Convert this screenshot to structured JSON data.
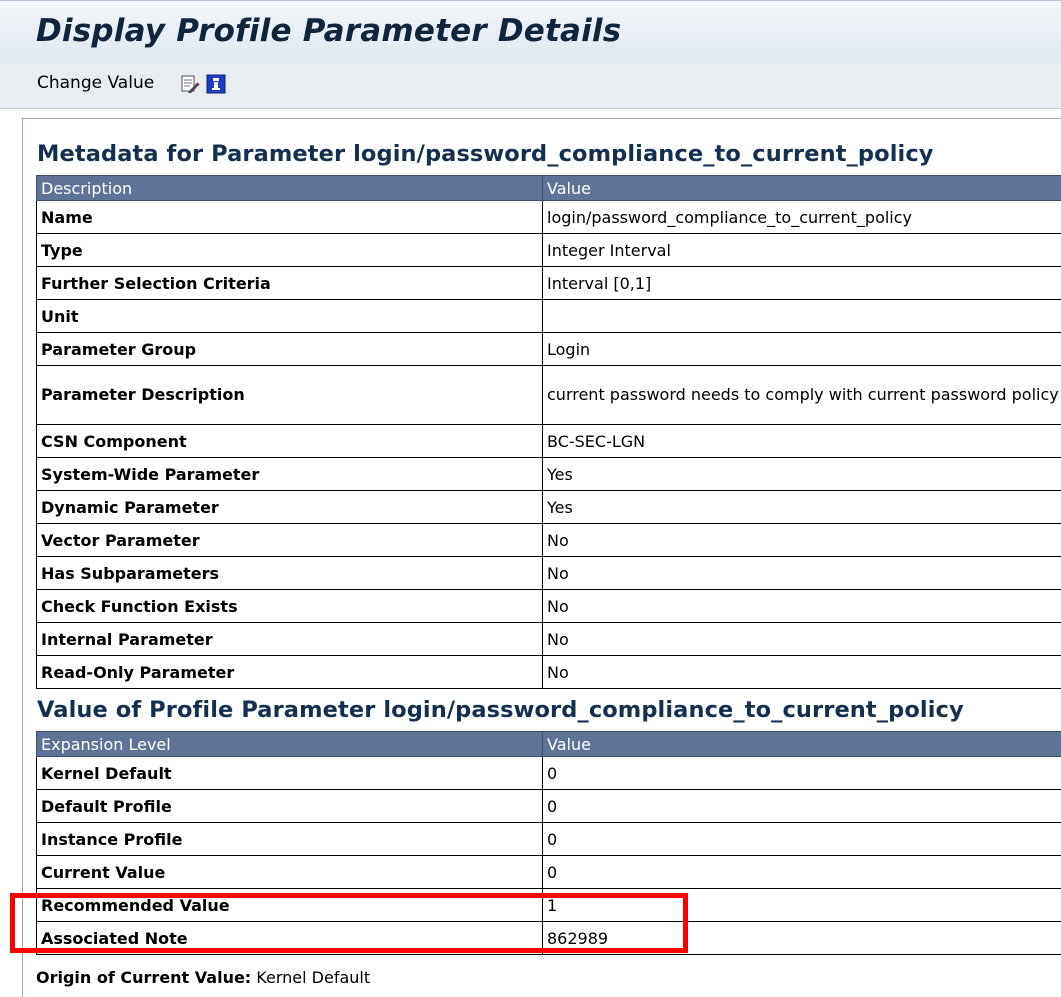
{
  "header": {
    "title": "Display Profile Parameter Details"
  },
  "toolbar": {
    "change_value_label": "Change Value",
    "icons": [
      "edit-icon",
      "info-icon"
    ]
  },
  "metadata_section": {
    "title": "Metadata for Parameter login/password_compliance_to_current_policy",
    "columns": [
      "Description",
      "Value"
    ],
    "rows": [
      {
        "key": "Name",
        "value": "login/password_compliance_to_current_policy"
      },
      {
        "key": "Type",
        "value": "Integer Interval"
      },
      {
        "key": "Further Selection Criteria",
        "value": "Interval [0,1]"
      },
      {
        "key": "Unit",
        "value": ""
      },
      {
        "key": "Parameter Group",
        "value": "Login"
      },
      {
        "key": "Parameter Description",
        "value": "current password needs to comply with current password policy"
      },
      {
        "key": "CSN Component",
        "value": "BC-SEC-LGN"
      },
      {
        "key": "System-Wide Parameter",
        "value": "Yes"
      },
      {
        "key": "Dynamic Parameter",
        "value": "Yes"
      },
      {
        "key": "Vector Parameter",
        "value": "No"
      },
      {
        "key": "Has Subparameters",
        "value": "No"
      },
      {
        "key": "Check Function Exists",
        "value": "No"
      },
      {
        "key": "Internal Parameter",
        "value": "No"
      },
      {
        "key": "Read-Only Parameter",
        "value": "No"
      }
    ]
  },
  "value_section": {
    "title": "Value of Profile Parameter login/password_compliance_to_current_policy",
    "columns": [
      "Expansion Level",
      "Value"
    ],
    "rows": [
      {
        "key": "Kernel Default",
        "value": "0"
      },
      {
        "key": "Default Profile",
        "value": "0"
      },
      {
        "key": "Instance Profile",
        "value": "0"
      },
      {
        "key": "Current Value",
        "value": "0"
      },
      {
        "key": "Recommended Value",
        "value": "1"
      },
      {
        "key": "Associated Note",
        "value": "862989"
      }
    ]
  },
  "origin": {
    "label": "Origin of Current Value:",
    "value": "Kernel Default"
  },
  "colors": {
    "header_row": "#5f7396",
    "section_title": "#15304f",
    "highlight": "#ff0000"
  }
}
